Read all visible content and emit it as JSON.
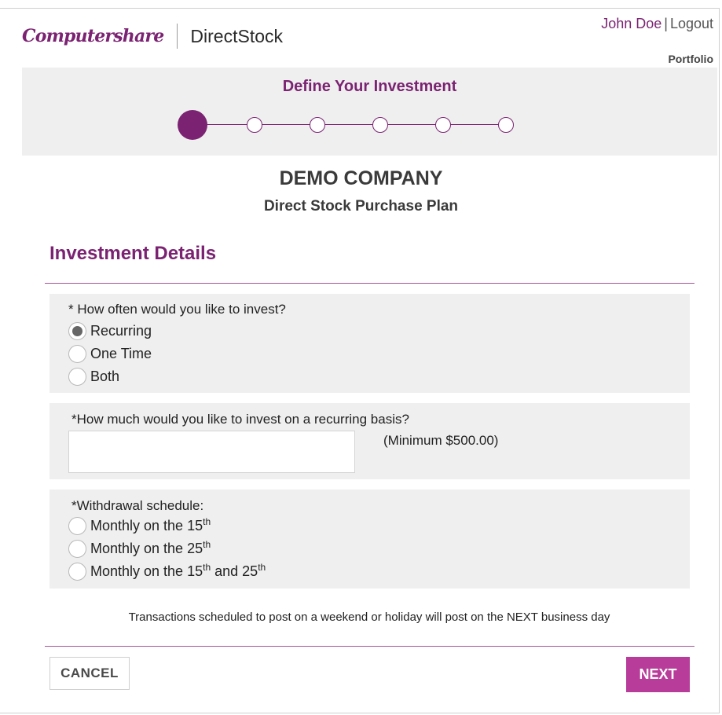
{
  "header": {
    "logo_text": "Computershare",
    "product": "DirectStock",
    "user_name": "John Doe",
    "separator": "|",
    "logout": "Logout",
    "portfolio": "Portfolio"
  },
  "wizard": {
    "title": "Define Your Investment",
    "total_steps": 6,
    "current_step": 1
  },
  "company": {
    "name": "DEMO COMPANY",
    "plan": "Direct Stock Purchase Plan"
  },
  "section_title": "Investment Details",
  "frequency": {
    "label": "* How often would you like to invest?",
    "options": [
      {
        "label": "Recurring",
        "selected": true
      },
      {
        "label": "One Time",
        "selected": false
      },
      {
        "label": "Both",
        "selected": false
      }
    ]
  },
  "amount": {
    "label": "*How much would you like to invest on a recurring basis?",
    "value": "",
    "placeholder": "",
    "minimum_note": "(Minimum $500.00)"
  },
  "schedule": {
    "label": "*Withdrawal schedule:",
    "options": [
      {
        "prefix": "Monthly on the 15",
        "sup1": "th",
        "mid": "",
        "sup2": ""
      },
      {
        "prefix": "Monthly on the 25",
        "sup1": "th",
        "mid": "",
        "sup2": ""
      },
      {
        "prefix": "Monthly on the 15",
        "sup1": "th",
        "mid": " and 25",
        "sup2": "th"
      }
    ]
  },
  "note": "Transactions scheduled to post on a weekend or holiday will post on the NEXT business day",
  "buttons": {
    "cancel": "CANCEL",
    "next": "NEXT"
  },
  "colors": {
    "brand": "#7b2372",
    "next_button": "#b83c9a",
    "panel_bg": "#efefef"
  }
}
